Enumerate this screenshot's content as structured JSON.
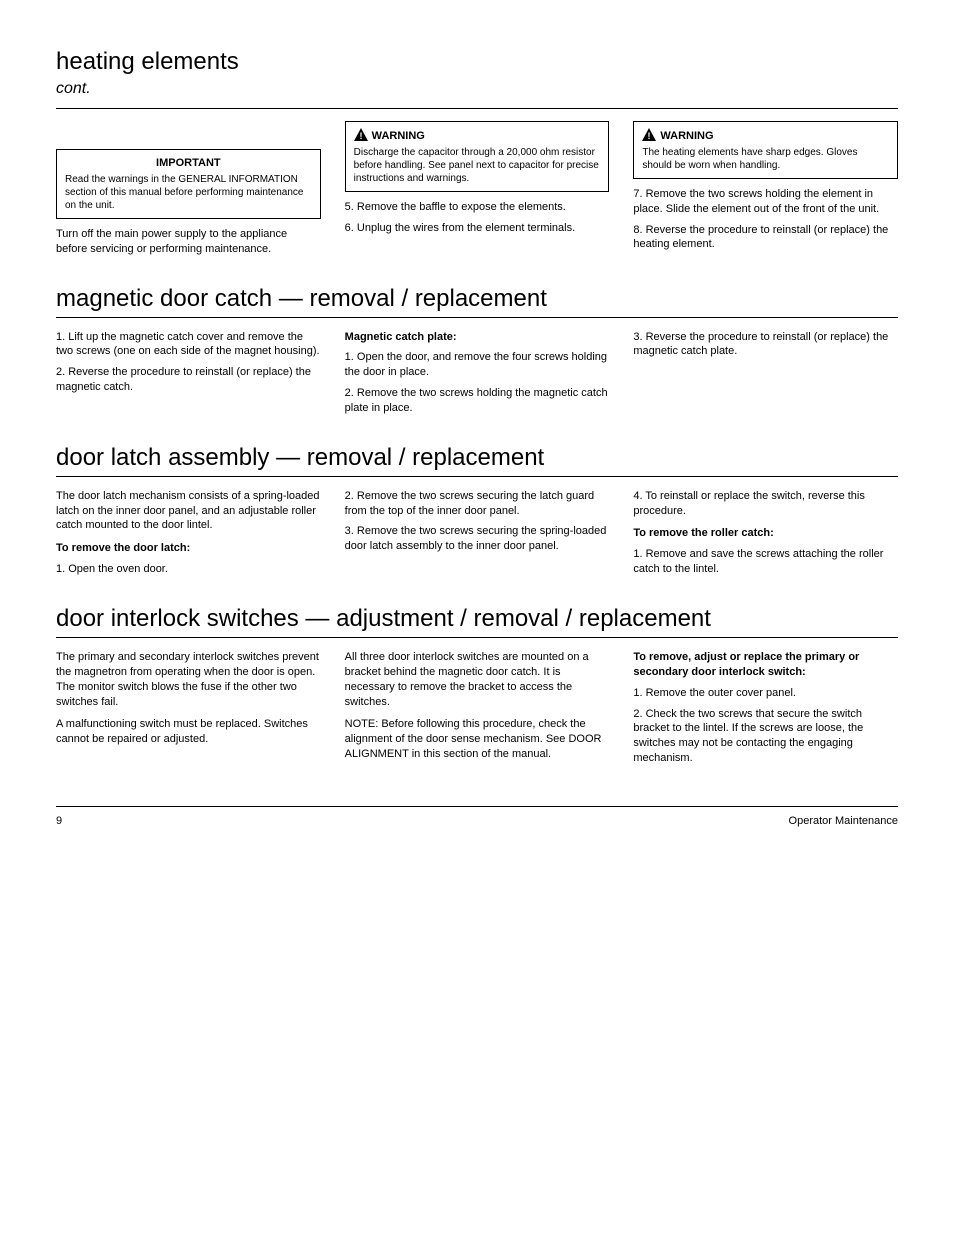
{
  "sections": {
    "heating": {
      "title": "heating elements",
      "sub": "cont.",
      "col1": {
        "important_title": "IMPORTANT",
        "important_body": "Read the warnings in the GENERAL INFORMATION section of this manual before performing maintenance on the unit.",
        "below": "Turn off the main power supply to the appliance before servicing or performing maintenance."
      },
      "col2": {
        "warn_label": "WARNING",
        "warn_body": "Discharge the capacitor through a 20,000 ohm resistor before handling. See panel next to capacitor for precise instructions and warnings.",
        "step5": "5. Remove the baffle to expose the elements.",
        "step6": "6. Unplug the wires from the element terminals."
      },
      "col3": {
        "warn_label": "WARNING",
        "warn_body": "The heating elements have sharp edges. Gloves should be worn when handling.",
        "step7": "7. Remove the two screws holding the element in place. Slide the element out of the front of the unit.",
        "step8": "8. Reverse the procedure to reinstall (or replace) the heating element."
      }
    },
    "doorcatch": {
      "title": "magnetic door catch — removal / replacement",
      "col1": {
        "step1": "1. Lift up the magnetic catch cover and remove the two screws (one on each side of the magnet housing).",
        "step2": "2. Reverse the procedure to reinstall (or replace) the magnetic catch."
      },
      "col2": {
        "plate_heading": "Magnetic catch plate:",
        "step1": "1. Open the door, and remove the four screws holding the door in place.",
        "step2": "2. Remove the two screws holding the magnetic catch plate in place."
      },
      "col3": {
        "step3": "3. Reverse the procedure to reinstall (or replace) the magnetic catch plate."
      }
    },
    "latch": {
      "title": "door latch assembly — removal / replacement",
      "col1": {
        "p1": "The door latch mechanism consists of a spring-loaded latch on the inner door panel, and an adjustable roller catch mounted to the door lintel.",
        "latch_heading": "To remove the door latch:",
        "step1": "1. Open the oven door."
      },
      "col2": {
        "step2": "2. Remove the two screws securing the latch guard from the top of the inner door panel.",
        "step3": "3. Remove the two screws securing the spring-loaded door latch assembly to the inner door panel."
      },
      "col3": {
        "step4": "4. To reinstall or replace the switch, reverse this procedure.",
        "roller_heading": "To remove the roller catch:",
        "step1": "1. Remove and save the screws attaching the roller catch to the lintel."
      }
    },
    "interlock": {
      "title": "door interlock switches — adjustment / removal / replacement",
      "col1": {
        "p1": "The primary and secondary interlock switches prevent the magnetron from operating when the door is open. The monitor switch blows the fuse if the other two switches fail.",
        "p2": "A malfunctioning switch must be replaced. Switches cannot be repaired or adjusted."
      },
      "col2": {
        "p1": "All three door interlock switches are mounted on a bracket behind the magnetic door catch. It is necessary to remove the bracket to access the switches.",
        "p2": "NOTE: Before following this procedure, check the alignment of the door sense mechanism. See DOOR ALIGNMENT in this section of the manual."
      },
      "col3": {
        "heading": "To remove, adjust or replace the primary or secondary door interlock switch:",
        "step1": "1. Remove the outer cover panel.",
        "step2": "2. Check the two screws that secure the switch bracket to the lintel. If the screws are loose, the switches may not be contacting the engaging mechanism."
      }
    }
  },
  "footer": {
    "page": "9",
    "title": "Operator Maintenance"
  }
}
